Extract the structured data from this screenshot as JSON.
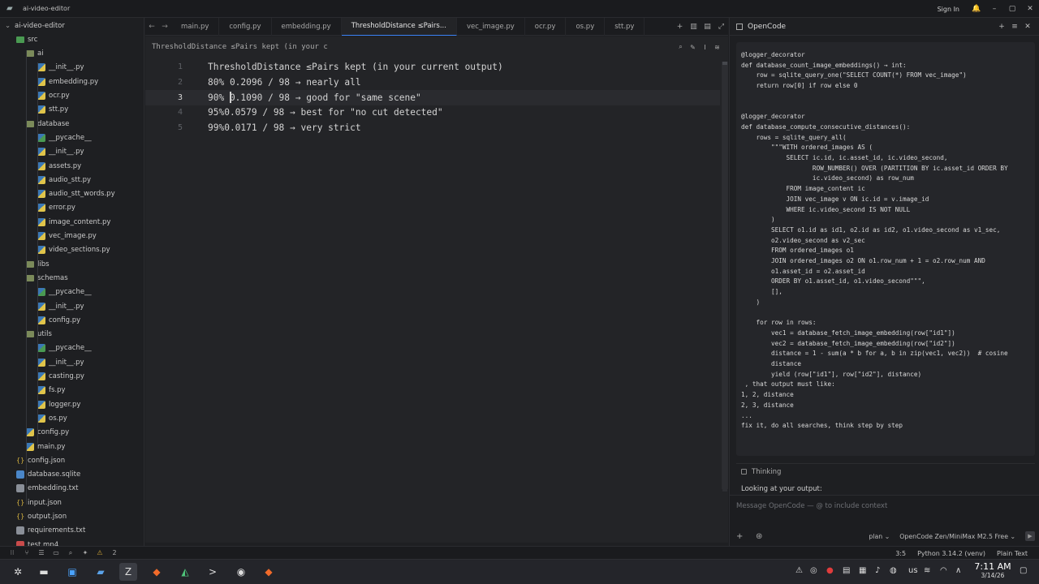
{
  "window": {
    "title": "ai-video-editor",
    "sign_in": "Sign In",
    "buttons": [
      "bell-icon",
      "minimize-icon",
      "maximize-icon",
      "close-icon"
    ]
  },
  "sidebar": {
    "project": "ai-video-editor",
    "rows": [
      {
        "label": "ai-video-editor",
        "kind": "root",
        "depth": 0
      },
      {
        "label": "src",
        "kind": "folder-src",
        "depth": 1
      },
      {
        "label": "ai",
        "kind": "folder",
        "depth": 2
      },
      {
        "label": "__init__.py",
        "kind": "py",
        "depth": 3
      },
      {
        "label": "embedding.py",
        "kind": "py",
        "depth": 3
      },
      {
        "label": "ocr.py",
        "kind": "py",
        "depth": 3
      },
      {
        "label": "stt.py",
        "kind": "py",
        "depth": 3
      },
      {
        "label": "database",
        "kind": "folder",
        "depth": 2
      },
      {
        "label": "__pycache__",
        "kind": "pycache",
        "depth": 3
      },
      {
        "label": "__init__.py",
        "kind": "py",
        "depth": 3
      },
      {
        "label": "assets.py",
        "kind": "py",
        "depth": 3
      },
      {
        "label": "audio_stt.py",
        "kind": "py",
        "depth": 3
      },
      {
        "label": "audio_stt_words.py",
        "kind": "py",
        "depth": 3
      },
      {
        "label": "error.py",
        "kind": "py",
        "depth": 3
      },
      {
        "label": "image_content.py",
        "kind": "py",
        "depth": 3
      },
      {
        "label": "vec_image.py",
        "kind": "py",
        "depth": 3
      },
      {
        "label": "video_sections.py",
        "kind": "py",
        "depth": 3
      },
      {
        "label": "libs",
        "kind": "folder",
        "depth": 2
      },
      {
        "label": "schemas",
        "kind": "folder",
        "depth": 2
      },
      {
        "label": "__pycache__",
        "kind": "pycache",
        "depth": 3
      },
      {
        "label": "__init__.py",
        "kind": "py",
        "depth": 3
      },
      {
        "label": "config.py",
        "kind": "py",
        "depth": 3
      },
      {
        "label": "utils",
        "kind": "folder",
        "depth": 2
      },
      {
        "label": "__pycache__",
        "kind": "pycache",
        "depth": 3
      },
      {
        "label": "__init__.py",
        "kind": "py",
        "depth": 3
      },
      {
        "label": "casting.py",
        "kind": "py",
        "depth": 3
      },
      {
        "label": "fs.py",
        "kind": "py",
        "depth": 3
      },
      {
        "label": "logger.py",
        "kind": "py",
        "depth": 3
      },
      {
        "label": "os.py",
        "kind": "py",
        "depth": 3
      },
      {
        "label": "config.py",
        "kind": "py",
        "depth": 2
      },
      {
        "label": "main.py",
        "kind": "py",
        "depth": 2
      },
      {
        "label": "config.json",
        "kind": "json",
        "depth": 1
      },
      {
        "label": "database.sqlite",
        "kind": "db",
        "depth": 1
      },
      {
        "label": "embedding.txt",
        "kind": "txt",
        "depth": 1
      },
      {
        "label": "input.json",
        "kind": "json",
        "depth": 1
      },
      {
        "label": "output.json",
        "kind": "json",
        "depth": 1
      },
      {
        "label": "requirements.txt",
        "kind": "req",
        "depth": 1
      },
      {
        "label": "test.mp4",
        "kind": "mp4",
        "depth": 1
      }
    ]
  },
  "tabs": [
    {
      "label": "main.py",
      "active": false
    },
    {
      "label": "config.py",
      "active": false
    },
    {
      "label": "embedding.py",
      "active": false
    },
    {
      "label": "ThresholdDistance ≤Pairs...",
      "active": true
    },
    {
      "label": "vec_image.py",
      "active": false
    },
    {
      "label": "ocr.py",
      "active": false
    },
    {
      "label": "os.py",
      "active": false
    },
    {
      "label": "stt.py",
      "active": false
    }
  ],
  "breadcrumb": "ThresholdDistance ≤Pairs kept (in your c",
  "editor": {
    "lines": [
      {
        "num": "1",
        "text": "ThresholdDistance ≤Pairs kept (in your current output)"
      },
      {
        "num": "2",
        "text": "80% 0.2096 / 98 → nearly all"
      },
      {
        "num": "3",
        "text": "90% 0.1090 / 98 → good for \"same scene\""
      },
      {
        "num": "4",
        "text": "95%0.0579 / 98 → best for \"no cut detected\""
      },
      {
        "num": "5",
        "text": "99%0.0171 / 98 → very strict"
      }
    ],
    "current_line": 3
  },
  "panel": {
    "title": "OpenCode",
    "message_lines": [
      "@logger_decorator",
      "def database_count_image_embeddings() → int:",
      "    row = sqlite_query_one(\"SELECT COUNT(*) FROM vec_image\")",
      "    return row[0] if row else 0",
      "",
      "",
      "@logger_decorator",
      "def database_compute_consecutive_distances():",
      "    rows = sqlite_query_all(",
      "        \"\"\"WITH ordered_images AS (",
      "            SELECT ic.id, ic.asset_id, ic.video_second,",
      "                   ROW_NUMBER() OVER (PARTITION BY ic.asset_id ORDER BY",
      "                   ic.video_second) as row_num",
      "            FROM image_content ic",
      "            JOIN vec_image v ON ic.id = v.image_id",
      "            WHERE ic.video_second IS NOT NULL",
      "        )",
      "        SELECT o1.id as id1, o2.id as id2, o1.video_second as v1_sec,",
      "        o2.video_second as v2_sec",
      "        FROM ordered_images o1",
      "        JOIN ordered_images o2 ON o1.row_num + 1 = o2.row_num AND",
      "        o1.asset_id = o2.asset_id",
      "        ORDER BY o1.asset_id, o1.video_second\"\"\",",
      "        [],",
      "    )",
      "",
      "    for row in rows:",
      "        vec1 = database_fetch_image_embedding(row[\"id1\"])",
      "        vec2 = database_fetch_image_embedding(row[\"id2\"])",
      "        distance = 1 - sum(a * b for a, b in zip(vec1, vec2))  # cosine",
      "        distance",
      "        yield (row[\"id1\"], row[\"id2\"], distance)",
      " , that output must like:",
      "1, 2, distance",
      "2, 3, distance",
      "...",
      "fix it, do all searches, think step by step"
    ],
    "thinking_label": "Thinking",
    "looking_text": "Looking at your output:",
    "composer_placeholder": "Message OpenCode — @ to include context",
    "mode": "plan ⌄",
    "model": "OpenCode Zen/MiniMax M2.5 Free ⌄"
  },
  "status": {
    "warnings": "2",
    "position": "3:5",
    "python": "Python 3.14.2 (venv)",
    "language": "Plain Text"
  },
  "taskbar": {
    "time": "7:11 AM",
    "date": "3/14/26",
    "lang": "us"
  }
}
